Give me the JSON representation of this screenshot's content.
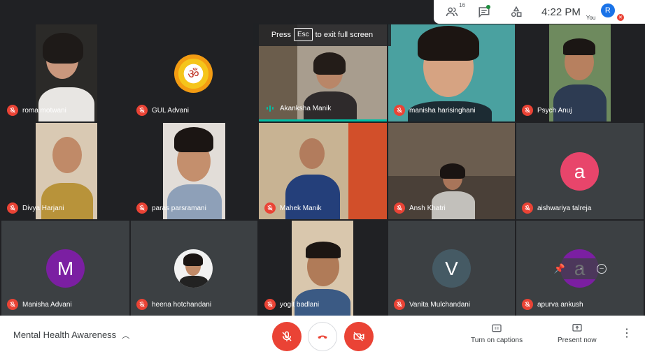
{
  "top_status": {
    "participants_count": "16",
    "clock": "4:22 PM",
    "self_initial": "R",
    "self_label": "You"
  },
  "fullscreen_note": {
    "before": "Press",
    "key": "Esc",
    "after": "to exit full screen"
  },
  "participants": [
    {
      "name": "roma motwani"
    },
    {
      "name": "GUL Advani"
    },
    {
      "name": "Akanksha Manik"
    },
    {
      "name": "manisha harisinghani"
    },
    {
      "name": "Psych Anuj"
    },
    {
      "name": "Divya Harjani"
    },
    {
      "name": "paras parsramani"
    },
    {
      "name": "Mahek Manik"
    },
    {
      "name": "Ansh Khatri"
    },
    {
      "name": "aishwariya talreja",
      "initial": "a"
    },
    {
      "name": "Manisha Advani",
      "initial": "M"
    },
    {
      "name": "heena hotchandani"
    },
    {
      "name": "yogit badlani"
    },
    {
      "name": "Vanita Mulchandani",
      "initial": "V"
    },
    {
      "name": "apurva ankush",
      "initial": "a"
    }
  ],
  "colors": {
    "mic_off": "#ea4335",
    "speaking": "#00bfa5",
    "avatar_pink": "#e8456b",
    "avatar_purple": "#7b1fa2",
    "avatar_slate": "#455a64"
  },
  "bottom_bar": {
    "meeting_title": "Mental Health Awareness",
    "captions_label": "Turn on captions",
    "present_label": "Present now"
  }
}
